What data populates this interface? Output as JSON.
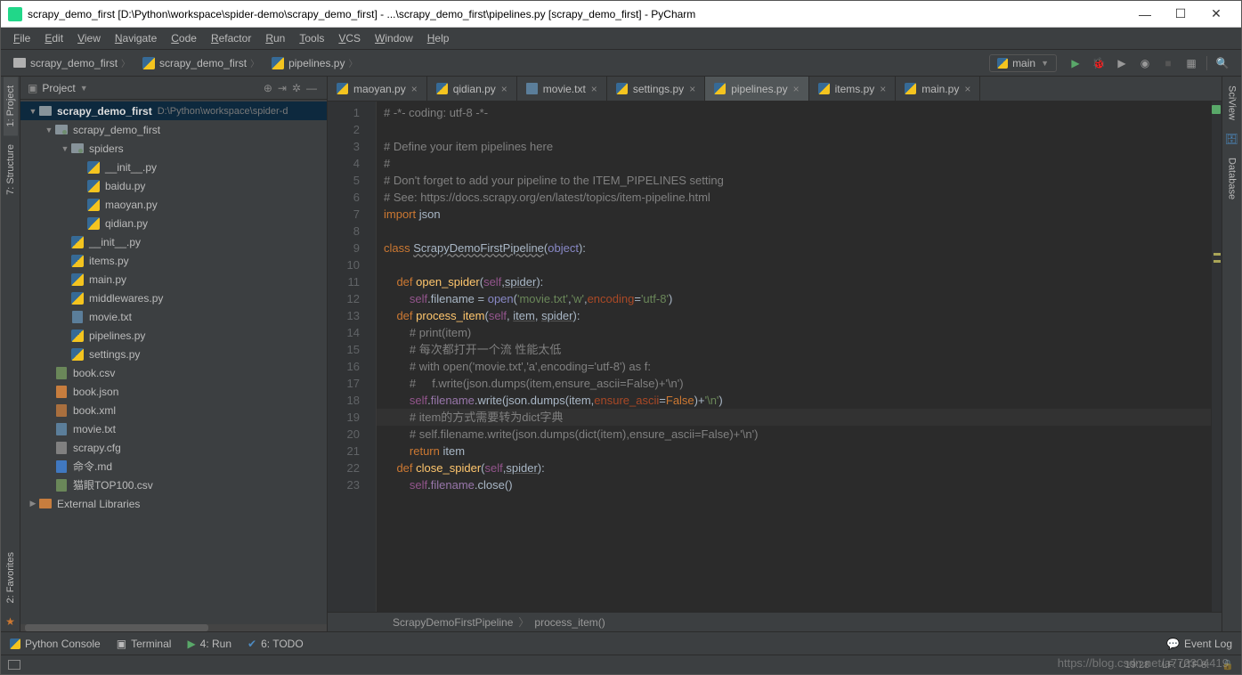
{
  "title": "scrapy_demo_first [D:\\Python\\workspace\\spider-demo\\scrapy_demo_first] - ...\\scrapy_demo_first\\pipelines.py [scrapy_demo_first] - PyCharm",
  "menu": [
    "File",
    "Edit",
    "View",
    "Navigate",
    "Code",
    "Refactor",
    "Run",
    "Tools",
    "VCS",
    "Window",
    "Help"
  ],
  "navcrumbs": [
    {
      "icon": "folder",
      "label": "scrapy_demo_first"
    },
    {
      "icon": "py",
      "label": "scrapy_demo_first"
    },
    {
      "icon": "py",
      "label": "pipelines.py"
    }
  ],
  "run_config": "main",
  "project_panel_title": "Project",
  "tree": [
    {
      "d": 0,
      "arrow": "▼",
      "icon": "folder",
      "label": "scrapy_demo_first",
      "bold": true,
      "path": "D:\\Python\\workspace\\spider-d",
      "sel": true
    },
    {
      "d": 1,
      "arrow": "▼",
      "icon": "pkg",
      "label": "scrapy_demo_first"
    },
    {
      "d": 2,
      "arrow": "▼",
      "icon": "pkg",
      "label": "spiders"
    },
    {
      "d": 3,
      "arrow": "",
      "icon": "py",
      "label": "__init__.py"
    },
    {
      "d": 3,
      "arrow": "",
      "icon": "py",
      "label": "baidu.py"
    },
    {
      "d": 3,
      "arrow": "",
      "icon": "py",
      "label": "maoyan.py"
    },
    {
      "d": 3,
      "arrow": "",
      "icon": "py",
      "label": "qidian.py"
    },
    {
      "d": 2,
      "arrow": "",
      "icon": "py",
      "label": "__init__.py"
    },
    {
      "d": 2,
      "arrow": "",
      "icon": "py",
      "label": "items.py"
    },
    {
      "d": 2,
      "arrow": "",
      "icon": "py",
      "label": "main.py"
    },
    {
      "d": 2,
      "arrow": "",
      "icon": "py",
      "label": "middlewares.py"
    },
    {
      "d": 2,
      "arrow": "",
      "icon": "txt",
      "label": "movie.txt"
    },
    {
      "d": 2,
      "arrow": "",
      "icon": "py",
      "label": "pipelines.py"
    },
    {
      "d": 2,
      "arrow": "",
      "icon": "py",
      "label": "settings.py"
    },
    {
      "d": 1,
      "arrow": "",
      "icon": "csv",
      "label": "book.csv"
    },
    {
      "d": 1,
      "arrow": "",
      "icon": "json",
      "label": "book.json"
    },
    {
      "d": 1,
      "arrow": "",
      "icon": "xml",
      "label": "book.xml"
    },
    {
      "d": 1,
      "arrow": "",
      "icon": "txt",
      "label": "movie.txt"
    },
    {
      "d": 1,
      "arrow": "",
      "icon": "cfg",
      "label": "scrapy.cfg"
    },
    {
      "d": 1,
      "arrow": "",
      "icon": "md",
      "label": "命令.md"
    },
    {
      "d": 1,
      "arrow": "",
      "icon": "csv",
      "label": "猫眼TOP100.csv"
    },
    {
      "d": 0,
      "arrow": "▶",
      "icon": "lib",
      "label": "External Libraries"
    }
  ],
  "tabs": [
    {
      "icon": "py",
      "label": "maoyan.py"
    },
    {
      "icon": "py",
      "label": "qidian.py"
    },
    {
      "icon": "txt",
      "label": "movie.txt"
    },
    {
      "icon": "py",
      "label": "settings.py"
    },
    {
      "icon": "py",
      "label": "pipelines.py",
      "active": true
    },
    {
      "icon": "py",
      "label": "items.py"
    },
    {
      "icon": "py",
      "label": "main.py"
    }
  ],
  "code_lines": 23,
  "editor_crumb": [
    "ScrapyDemoFirstPipeline",
    "process_item()"
  ],
  "bottom_tools": {
    "console": "Python Console",
    "terminal": "Terminal",
    "run": "4: Run",
    "todo": "6: TODO",
    "eventlog": "Event Log"
  },
  "status": {
    "pos": "19:28",
    "enc": "LF:   UTF-8:"
  },
  "watermark": "https://blog.csdn.net/a772304419",
  "left_tabs": [
    "1: Project",
    "7: Structure"
  ],
  "left_bottom_tab": "2: Favorites",
  "right_tabs": [
    "SciView",
    "Database"
  ]
}
